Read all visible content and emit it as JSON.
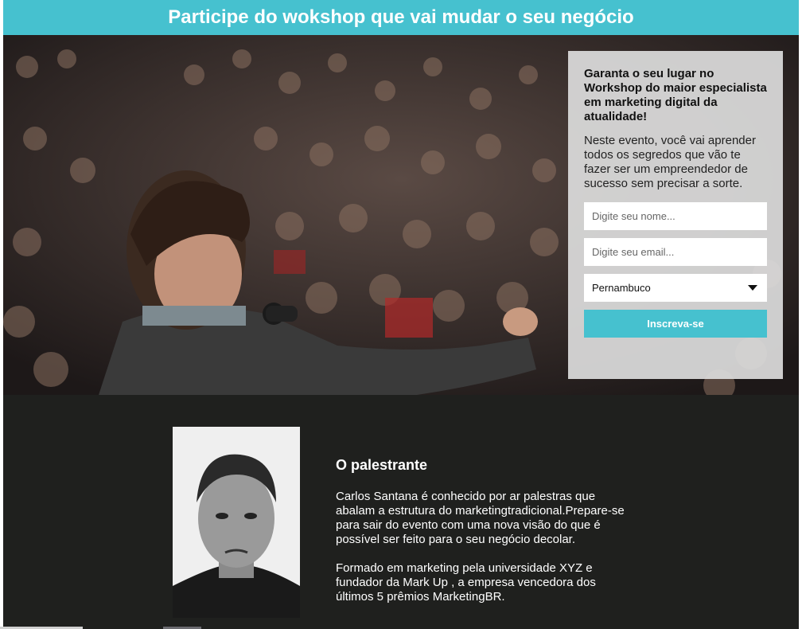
{
  "header": {
    "title": "Participe do wokshop que vai mudar o seu negócio"
  },
  "form": {
    "heading": "Garanta o seu lugar no Workshop do maior especialista em marketing digital da atualidade!",
    "description": "Neste evento, você vai aprender todos os segredos que vão te fazer ser um empreendedor de sucesso sem precisar a sorte.",
    "name_placeholder": "Digite seu nome...",
    "email_placeholder": "Digite seu email...",
    "state_selected": "Pernambuco",
    "submit_label": "Inscreva-se"
  },
  "speaker": {
    "title": "O palestrante",
    "paragraph1": "Carlos Santana é conhecido por ar palestras que abalam a estrutura do marketingtradicional.Prepare-se para sair do evento com uma nova visão do que é possível ser feito para o seu negócio decolar.",
    "paragraph2": "Formado em marketing pela universidade XYZ e fundador da Mark Up , a empresa vencedora dos últimos 5 prêmios MarketingBR."
  },
  "colors": {
    "accent": "#46c1cf",
    "dark_section": "#1f201e"
  },
  "icons": {
    "select_caret": "caret-down-icon"
  }
}
